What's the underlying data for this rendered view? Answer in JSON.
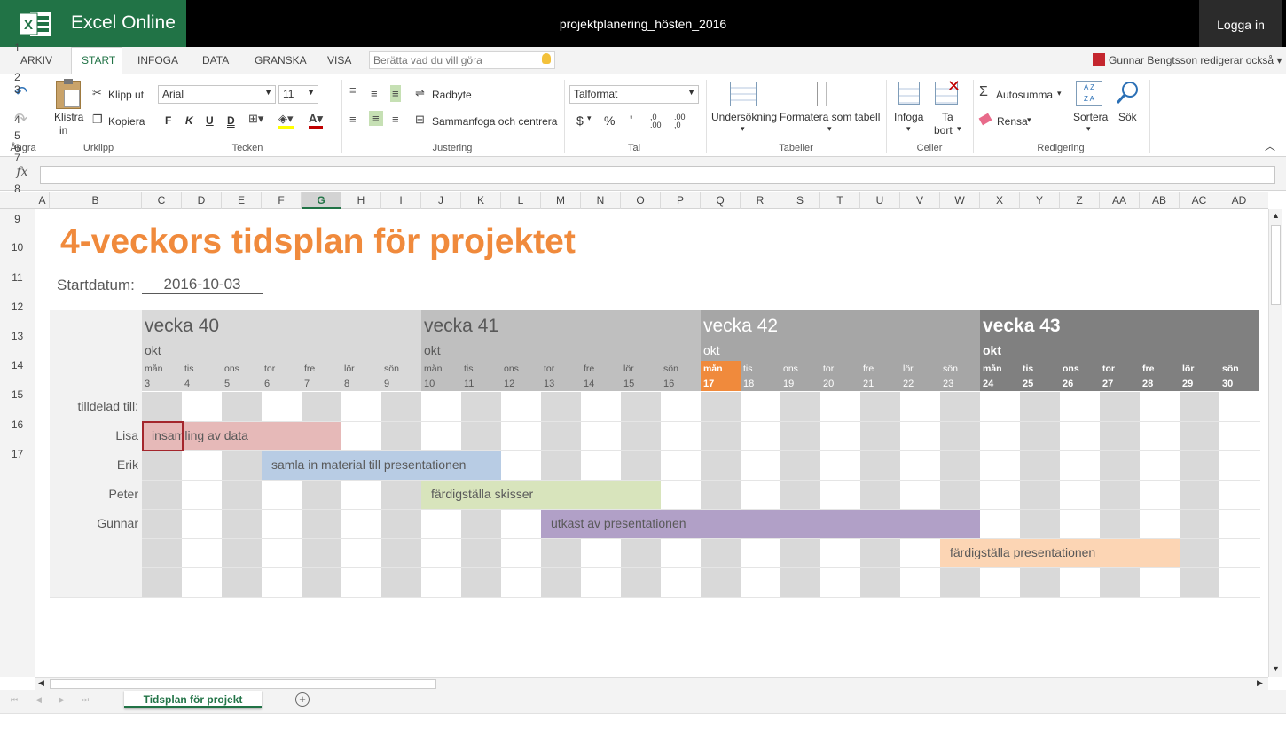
{
  "app": {
    "name": "Excel Online",
    "document_title": "projektplanering_hösten_2016",
    "login": "Logga in"
  },
  "tabs": [
    "ARKIV",
    "START",
    "INFOGA",
    "DATA",
    "GRANSKA",
    "VISA"
  ],
  "active_tab": "START",
  "tell_me_placeholder": "Berätta vad du vill göra",
  "editors_text": "Gunnar Bengtsson redigerar också",
  "ribbon": {
    "undo_group": "Ångra",
    "clipboard": {
      "paste": "Klistra",
      "paste2": "in",
      "cut": "Klipp ut",
      "copy": "Kopiera",
      "label": "Urklipp"
    },
    "font": {
      "family": "Arial",
      "size": "11",
      "bold": "F",
      "italic": "K",
      "underline": "U",
      "dunderline": "D",
      "label": "Tecken"
    },
    "alignment": {
      "wrap": "Radbyte",
      "merge": "Sammanfoga och centrera",
      "label": "Justering"
    },
    "number": {
      "format": "Talformat",
      "currency": "$",
      "percent": "%",
      "comma": "'",
      "inc": ",0 .00",
      "dec": ".00 ,0",
      "label": "Tal"
    },
    "tables": {
      "survey": "Undersökning",
      "format_table": "Formatera som tabell",
      "label": "Tabeller"
    },
    "cells": {
      "insert": "Infoga",
      "delete": "Ta",
      "delete2": "bort",
      "label": "Celler"
    },
    "editing": {
      "autosum": "Autosumma",
      "clear": "Rensa",
      "sort": "Sortera",
      "find": "Sök",
      "label": "Redigering"
    }
  },
  "formula": {
    "fx": "fx",
    "value": ""
  },
  "columns": [
    "A",
    "B",
    "C",
    "D",
    "E",
    "F",
    "G",
    "H",
    "I",
    "J",
    "K",
    "L",
    "M",
    "N",
    "O",
    "P",
    "Q",
    "R",
    "S",
    "T",
    "U",
    "V",
    "W",
    "X",
    "Y",
    "Z",
    "AA",
    "AB",
    "AC",
    "AD"
  ],
  "selected_column": "G",
  "rows": [
    "1",
    "2",
    "3",
    "4",
    "5",
    "6",
    "7",
    "8",
    "9",
    "10",
    "11",
    "12",
    "13",
    "14",
    "15",
    "16",
    "17"
  ],
  "sheet": {
    "title": "4-veckors tidsplan för projektet",
    "start_label": "Startdatum:",
    "start_date": "2016-10-03",
    "assigned_label": "tilldelad till:",
    "weeks": [
      {
        "name": "vecka 40",
        "month": "okt",
        "bg": "#d9d9d9",
        "fg": "#595959"
      },
      {
        "name": "vecka 41",
        "month": "okt",
        "bg": "#bfbfbf",
        "fg": "#595959"
      },
      {
        "name": "vecka 42",
        "month": "okt",
        "bg": "#a6a6a6",
        "fg": "#ffffff"
      },
      {
        "name": "vecka 43",
        "month": "okt",
        "bg": "#808080",
        "fg": "#ffffff"
      }
    ],
    "day_names": [
      "mån",
      "tis",
      "ons",
      "tor",
      "fre",
      "lör",
      "sön"
    ],
    "day_numbers": [
      "3",
      "4",
      "5",
      "6",
      "7",
      "8",
      "9",
      "10",
      "11",
      "12",
      "13",
      "14",
      "15",
      "16",
      "17",
      "18",
      "19",
      "20",
      "21",
      "22",
      "23",
      "24",
      "25",
      "26",
      "27",
      "28",
      "29",
      "30"
    ],
    "today_index": 14,
    "today_color": "#f08a3c",
    "people": [
      "Lisa",
      "Erik",
      "Peter",
      "Gunnar",
      ""
    ],
    "tasks": [
      {
        "person": "Lisa",
        "label": "insamling av data",
        "start": 0,
        "days": 5,
        "color": "#e6b9b8"
      },
      {
        "person": "Erik",
        "label": "samla in material till presentationen",
        "start": 3,
        "days": 6,
        "color": "#b8cce4"
      },
      {
        "person": "Peter",
        "label": "färdigställa skisser",
        "start": 7,
        "days": 6,
        "color": "#d8e4bc"
      },
      {
        "person": "Gunnar",
        "label": "utkast av presentationen",
        "start": 10,
        "days": 11,
        "color": "#b1a0c7"
      },
      {
        "person": "",
        "label": "färdigställa presentationen",
        "start": 20,
        "days": 6,
        "color": "#fcd5b4"
      }
    ]
  },
  "sheet_tab": "Tidsplan för projekt"
}
